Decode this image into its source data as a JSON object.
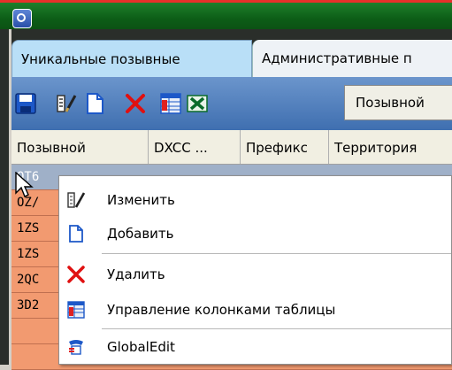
{
  "tabs": [
    {
      "label": "Уникальные позывные",
      "active": true
    },
    {
      "label": "Административные п",
      "active": false
    }
  ],
  "toolbar": {
    "buttons": [
      {
        "icon": "save-icon"
      },
      {
        "icon": "edit-icon"
      },
      {
        "icon": "new-document-icon"
      },
      {
        "icon": "delete-icon"
      },
      {
        "icon": "columns-icon"
      },
      {
        "icon": "excel-icon"
      }
    ],
    "search_value": "Позывной"
  },
  "table": {
    "columns": [
      "Позывной",
      "DXCC ...",
      "Префикс",
      "Территория"
    ],
    "rows": [
      "OT6",
      "OZ/",
      "1ZS",
      "1ZS",
      "2QC",
      "3D2"
    ]
  },
  "context_menu": {
    "items": [
      {
        "label": "Изменить",
        "icon": "edit-icon"
      },
      {
        "label": "Добавить",
        "icon": "new-document-icon"
      },
      {
        "label": "Удалить",
        "icon": "delete-icon"
      },
      {
        "label": "Управление колонками таблицы",
        "icon": "columns-icon"
      },
      {
        "label": "GlobalEdit",
        "icon": "global-edit-icon"
      }
    ]
  },
  "colors": {
    "titlebar": "#0d5e17",
    "toolbar": "#3f6fb0",
    "row_highlight": "#f29a70",
    "selected_row": "#9fb0c8"
  }
}
